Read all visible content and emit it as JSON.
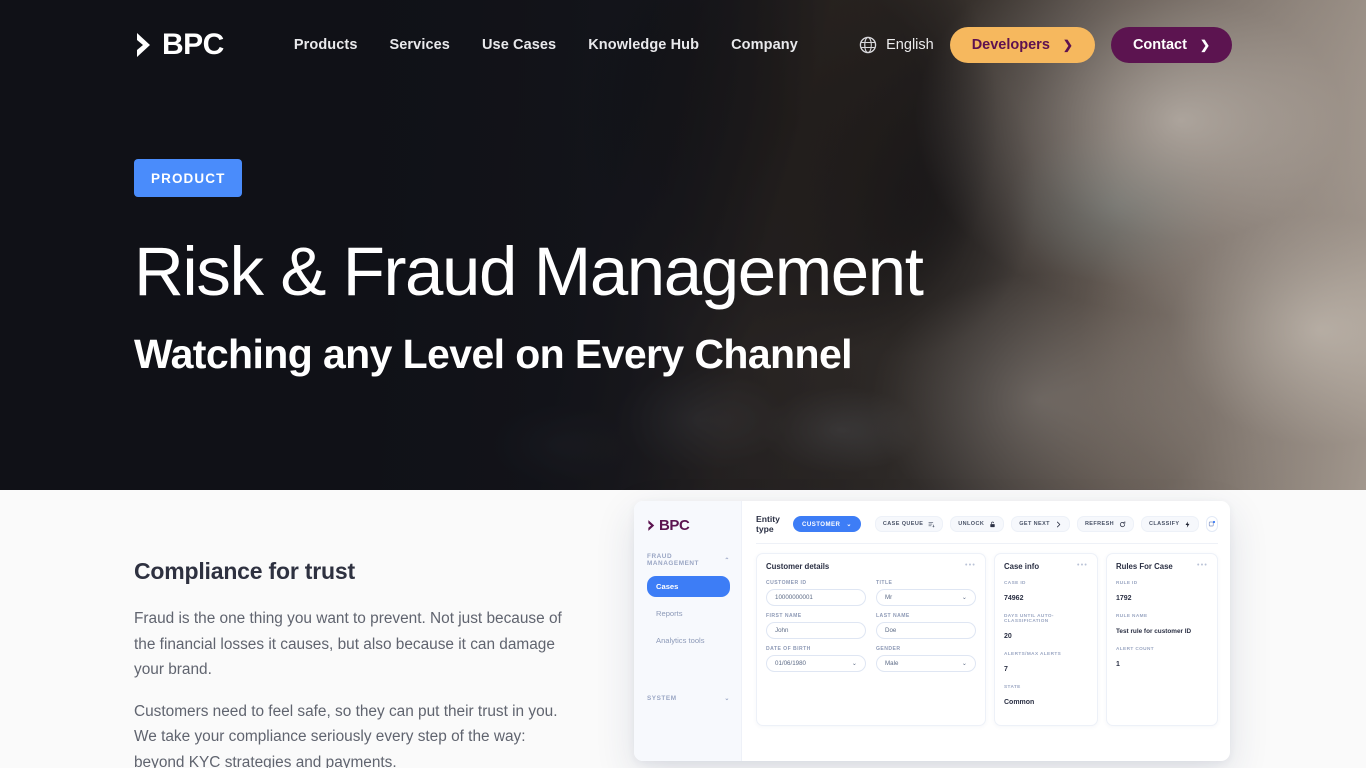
{
  "nav": {
    "logo_text": "BPC",
    "logo_icon": "chevron-right-icon",
    "links": [
      {
        "label": "Products"
      },
      {
        "label": "Services"
      },
      {
        "label": "Use Cases"
      },
      {
        "label": "Knowledge Hub"
      },
      {
        "label": "Company"
      }
    ],
    "language": {
      "icon": "globe-icon",
      "label": "English"
    },
    "developers_button": {
      "label": "Developers",
      "chevron": "❯",
      "bg": "#f6b85e",
      "fg": "#5d1150"
    },
    "contact_button": {
      "label": "Contact",
      "chevron": "❯",
      "bg": "#5c1450",
      "fg": "#ffffff"
    }
  },
  "hero": {
    "badge": "PRODUCT",
    "badge_color": "#4a8cfb",
    "title": "Risk & Fraud Management",
    "subtitle": "Watching any Level on Every Channel",
    "background": "#14151c"
  },
  "section": {
    "title": "Compliance for trust",
    "paragraphs": [
      "Fraud is the one thing you want to prevent. Not just because of the financial losses it causes, but also because it can damage your brand.",
      "Customers need to feel safe, so they can put their trust in you. We take your compliance seriously every step of the way: beyond KYC strategies and payments."
    ]
  },
  "mockup": {
    "logo_text": "BPC",
    "sidebar": {
      "groups": [
        {
          "label": "FRAUD MANAGEMENT",
          "caret": "⌃",
          "items": [
            {
              "label": "Cases",
              "active": true
            },
            {
              "label": "Reports",
              "active": false
            },
            {
              "label": "Analytics tools",
              "active": false
            }
          ]
        },
        {
          "label": "SYSTEM",
          "caret": "⌄",
          "items": []
        }
      ]
    },
    "toolbar": {
      "entity_label": "Entity type",
      "entity_value": "CUSTOMER",
      "entity_caret": "⌄",
      "buttons": [
        {
          "label": "CASE QUEUE",
          "icon": "list-settings-icon"
        },
        {
          "label": "UNLOCK",
          "icon": "lock-icon"
        },
        {
          "label": "GET NEXT",
          "icon": "chevron-right-icon"
        },
        {
          "label": "REFRESH",
          "icon": "refresh-icon"
        },
        {
          "label": "CLASSIFY",
          "icon": "bolt-icon"
        }
      ],
      "icon_button": {
        "icon": "sync-badge-icon"
      }
    },
    "customer_card": {
      "title": "Customer details",
      "menu": "•••",
      "fields": [
        {
          "label": "CUSTOMER ID",
          "value": "10000000001",
          "type": "text"
        },
        {
          "label": "TITLE",
          "value": "Mr",
          "type": "select"
        },
        {
          "label": "FIRST NAME",
          "value": "John",
          "type": "text"
        },
        {
          "label": "LAST NAME",
          "value": "Doe",
          "type": "text"
        },
        {
          "label": "DATE OF BIRTH",
          "value": "01/06/1980",
          "type": "select"
        },
        {
          "label": "GENDER",
          "value": "Male",
          "type": "select"
        }
      ]
    },
    "case_info_card": {
      "title": "Case info",
      "menu": "•••",
      "items": [
        {
          "label": "CASE ID",
          "value": "74962"
        },
        {
          "label": "DAYS UNTIL AUTO-CLASSIFICATION",
          "value": "20"
        },
        {
          "label": "ALERTS/MAX ALERTS",
          "value": "7"
        },
        {
          "label": "STATE",
          "value": "Common"
        }
      ]
    },
    "rules_card": {
      "title": "Rules For Case",
      "menu": "•••",
      "items": [
        {
          "label": "RULE ID",
          "value": "1792"
        },
        {
          "label": "RULE NAME",
          "value": "Test rule for customer ID"
        },
        {
          "label": "ALERT COUNT",
          "value": "1"
        }
      ]
    }
  }
}
